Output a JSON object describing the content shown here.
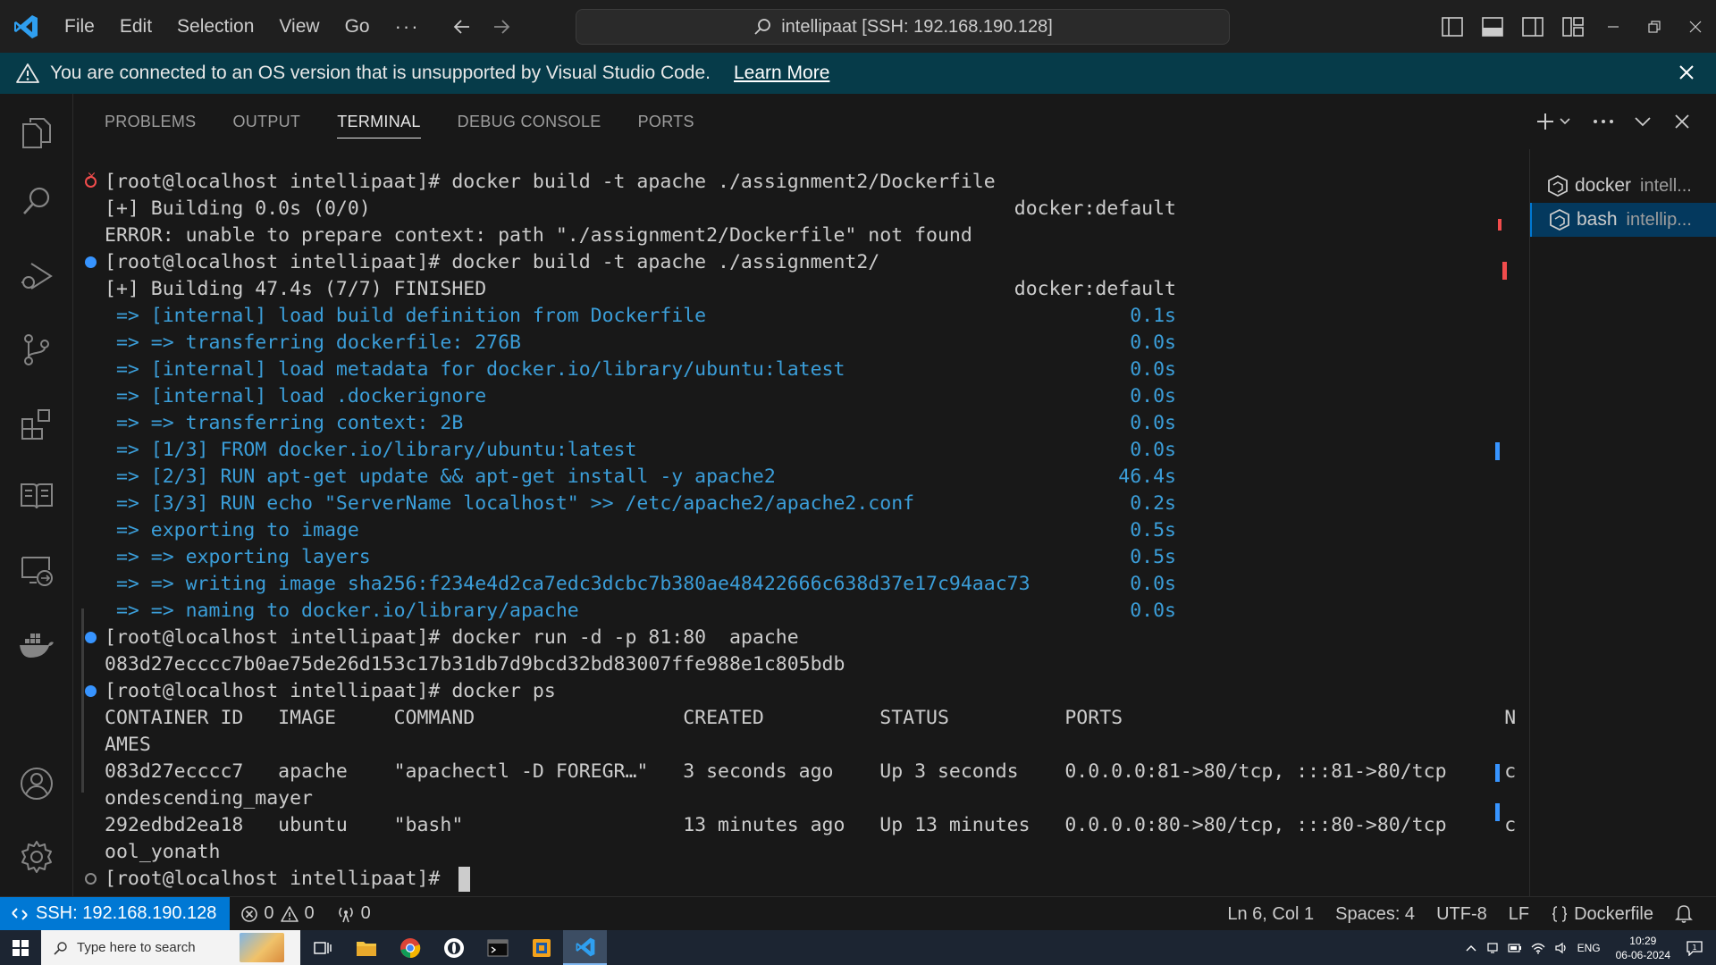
{
  "titlebar": {
    "menu": [
      "File",
      "Edit",
      "Selection",
      "View",
      "Go",
      "···"
    ],
    "command_center": "intellipaat [SSH: 192.168.190.128]"
  },
  "banner": {
    "message": "You are connected to an OS version that is unsupported by Visual Studio Code.",
    "link": "Learn More"
  },
  "panel": {
    "tabs": [
      "PROBLEMS",
      "OUTPUT",
      "TERMINAL",
      "DEBUG CONSOLE",
      "PORTS"
    ],
    "active_tab": "TERMINAL"
  },
  "terminal": {
    "lines": [
      {
        "deco": "err",
        "text": "[root@localhost intellipaat]# docker build -t apache ./assignment2/Dockerfile"
      },
      {
        "text": "[+] Building 0.0s (0/0)",
        "right": "docker:default"
      },
      {
        "text": "ERROR: unable to prepare context: path \"./assignment2/Dockerfile\" not found"
      },
      {
        "deco": "ok",
        "text": "[root@localhost intellipaat]# docker build -t apache ./assignment2/"
      },
      {
        "text": "[+] Building 47.4s (7/7) FINISHED",
        "right": "docker:default"
      },
      {
        "blue": true,
        "text": " => [internal] load build definition from Dockerfile",
        "right": "0.1s"
      },
      {
        "blue": true,
        "text": " => => transferring dockerfile: 276B",
        "right": "0.0s"
      },
      {
        "blue": true,
        "text": " => [internal] load metadata for docker.io/library/ubuntu:latest",
        "right": "0.0s"
      },
      {
        "blue": true,
        "text": " => [internal] load .dockerignore",
        "right": "0.0s"
      },
      {
        "blue": true,
        "text": " => => transferring context: 2B",
        "right": "0.0s"
      },
      {
        "blue": true,
        "text": " => [1/3] FROM docker.io/library/ubuntu:latest",
        "right": "0.0s"
      },
      {
        "blue": true,
        "text": " => [2/3] RUN apt-get update && apt-get install -y apache2",
        "right": "46.4s"
      },
      {
        "blue": true,
        "text": " => [3/3] RUN echo \"ServerName localhost\" >> /etc/apache2/apache2.conf",
        "right": "0.2s"
      },
      {
        "blue": true,
        "text": " => exporting to image",
        "right": "0.5s"
      },
      {
        "blue": true,
        "text": " => => exporting layers",
        "right": "0.5s"
      },
      {
        "blue": true,
        "text": " => => writing image sha256:f234e4d2ca7edc3dcbc7b380ae48422666c638d37e17c94aac73",
        "right": "0.0s"
      },
      {
        "blue": true,
        "text": " => => naming to docker.io/library/apache",
        "right": "0.0s"
      },
      {
        "deco": "ok",
        "text": "[root@localhost intellipaat]# docker run -d -p 81:80  apache"
      },
      {
        "text": "083d27ecccc7b0ae75de26d153c17b31db7d9bcd32bd83007ffe988e1c805bdb"
      },
      {
        "deco": "ok",
        "text": "[root@localhost intellipaat]# docker ps"
      },
      {
        "text": "CONTAINER ID   IMAGE     COMMAND                  CREATED          STATUS          PORTS                                 N"
      },
      {
        "text": "AMES"
      },
      {
        "text": "083d27ecccc7   apache    \"apachectl -D FOREGR…\"   3 seconds ago    Up 3 seconds    0.0.0.0:81->80/tcp, :::81->80/tcp     c"
      },
      {
        "text": "ondescending_mayer"
      },
      {
        "text": "292edbd2ea18   ubuntu    \"bash\"                   13 minutes ago   Up 13 minutes   0.0.0.0:80->80/tcp, :::80->80/tcp     c"
      },
      {
        "text": "ool_yonath"
      },
      {
        "deco": "empty",
        "text": "[root@localhost intellipaat]# ",
        "cursor": true
      }
    ]
  },
  "terminal_list": [
    {
      "name": "docker",
      "desc": "intell...",
      "active": false
    },
    {
      "name": "bash",
      "desc": "intellip...",
      "active": true
    }
  ],
  "statusbar": {
    "remote": "SSH: 192.168.190.128",
    "errors": "0",
    "warnings": "0",
    "ports": "0",
    "position": "Ln 6, Col 1",
    "spaces": "Spaces: 4",
    "encoding": "UTF-8",
    "eol": "LF",
    "language": "Dockerfile"
  },
  "taskbar": {
    "search_placeholder": "Type here to search",
    "lang": "ENG",
    "time": "10:29",
    "date": "06-06-2024"
  },
  "colors": {
    "accent": "#0078d4",
    "banner": "#063b49",
    "terminal_blue": "#3b9ed9",
    "error": "#f14c4c"
  }
}
